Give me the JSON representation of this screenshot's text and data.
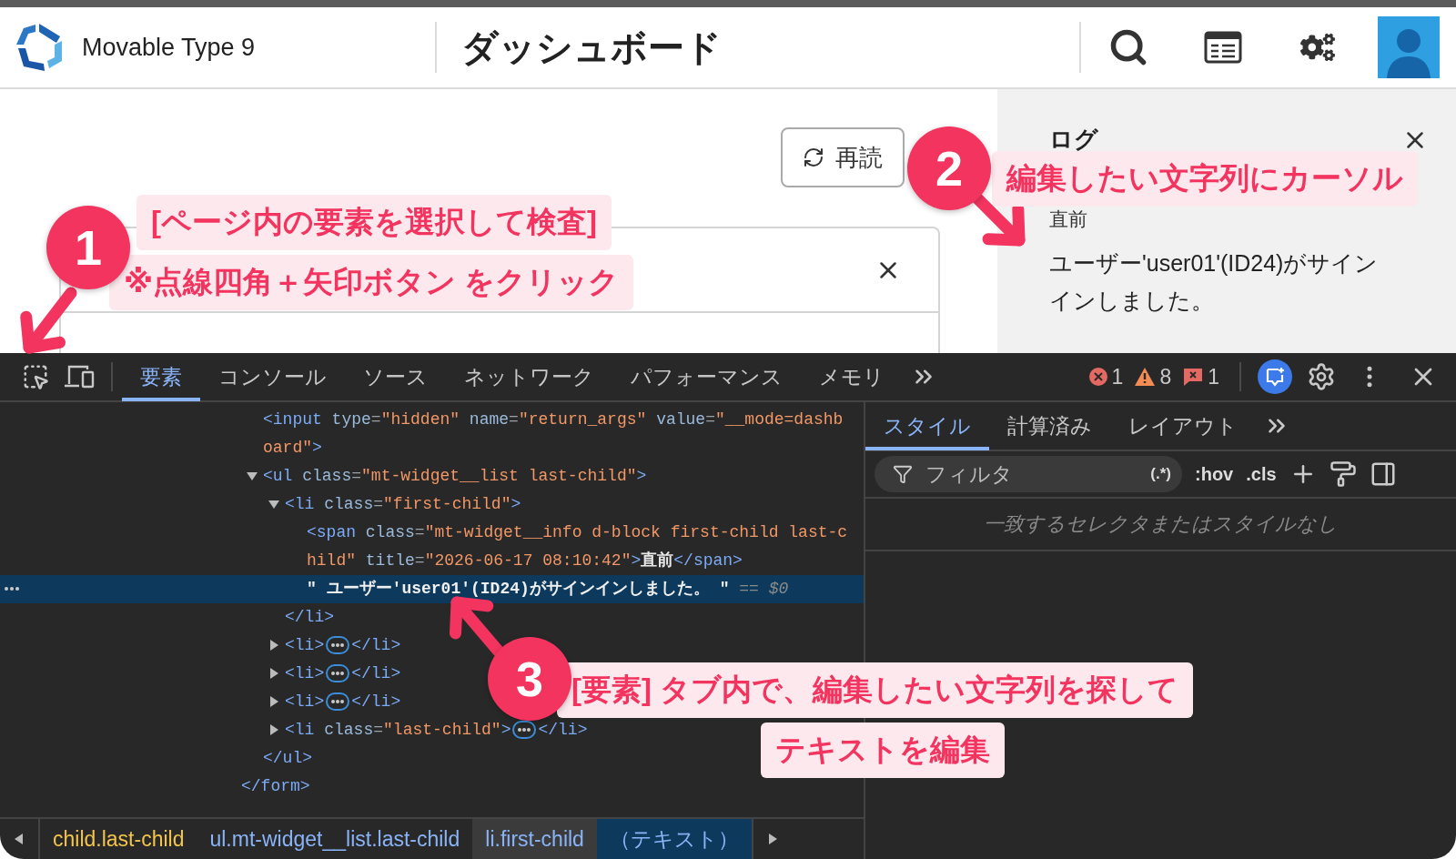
{
  "header": {
    "product_name": "Movable Type 9",
    "page_title": "ダッシュボード"
  },
  "reload_button": {
    "label": "再読"
  },
  "log_panel": {
    "title": "ログ",
    "entries": [
      {
        "time": "直前",
        "message": "ユーザー'user01'(ID24)がサインインしました。"
      }
    ]
  },
  "devtools": {
    "tabs": [
      {
        "label": "要素",
        "selected": true
      },
      {
        "label": "コンソール",
        "selected": false
      },
      {
        "label": "ソース",
        "selected": false
      },
      {
        "label": "ネットワーク",
        "selected": false
      },
      {
        "label": "パフォーマンス",
        "selected": false
      },
      {
        "label": "メモリ",
        "selected": false
      }
    ],
    "counts": [
      {
        "kind": "error",
        "value": "1"
      },
      {
        "kind": "warning",
        "value": "8"
      },
      {
        "kind": "issue",
        "value": "1"
      }
    ],
    "dom": {
      "children": [
        {
          "kind": "element",
          "selected": false,
          "code": "<input type=\"hidden\" name=\"return_args\" value=\"__mode=dashboard\">"
        },
        {
          "kind": "element",
          "selected": false,
          "expanded": true,
          "code": "<ul class=\"mt-widget__list last-child\">",
          "children": [
            {
              "kind": "element",
              "selected": false,
              "expanded": true,
              "code": "<li class=\"first-child\">",
              "children": [
                {
                  "kind": "element",
                  "selected": false,
                  "code": "<span class=\"mt-widget__info d-block first-child last-child\" title=\"2026-06-17 08:10:42\">直前</span>"
                },
                {
                  "kind": "text",
                  "selected": true,
                  "code": "\" ユーザー'user01'(ID24)がサインインしました。 \"",
                  "ref": "== $0"
                }
              ],
              "close": "</li>"
            },
            {
              "kind": "element",
              "selected": false,
              "expanded": false,
              "code": "<li>",
              "tail": "</li>"
            },
            {
              "kind": "element",
              "selected": false,
              "expanded": false,
              "code": "<li>",
              "tail": "</li>"
            },
            {
              "kind": "element",
              "selected": false,
              "expanded": false,
              "code": "<li>",
              "tail": "</li>"
            },
            {
              "kind": "element",
              "selected": false,
              "expanded": false,
              "code": "<li class=\"last-child\">",
              "tail": "</li>"
            }
          ],
          "close": "</ul>"
        }
      ],
      "close": "</form>"
    },
    "breadcrumbs": [
      {
        "label": "child.last-child",
        "color": "#f3c54d",
        "hovered": false,
        "selected": false
      },
      {
        "label": "ul.mt-widget__list.last-child",
        "color": "#8ab4f8",
        "hovered": false,
        "selected": false
      },
      {
        "label": "li.first-child",
        "color": "#8ab4f8",
        "hovered": true,
        "selected": false
      },
      {
        "label": "（テキスト）",
        "hovered": false,
        "selected": true
      }
    ],
    "styles": {
      "tabs": [
        {
          "label": "スタイル",
          "selected": true
        },
        {
          "label": "計算済み",
          "selected": false
        },
        {
          "label": "レイアウト",
          "selected": false
        }
      ],
      "filter_placeholder": "フィルタ",
      "regex_toggle": "(.*)",
      "hov": ":hov",
      "cls": ".cls",
      "empty_message": "一致するセレクタまたはスタイルなし"
    }
  },
  "annotations": [
    {
      "number": "1",
      "lines": [
        "[ページ内の要素を選択して検査]",
        "※点線四角＋矢印ボタン をクリック"
      ]
    },
    {
      "number": "2",
      "lines": [
        "編集したい文字列にカーソル"
      ]
    },
    {
      "number": "3",
      "lines": [
        "[要素] タブ内で、編集したい文字列を探して",
        "テキストを編集"
      ]
    }
  ]
}
